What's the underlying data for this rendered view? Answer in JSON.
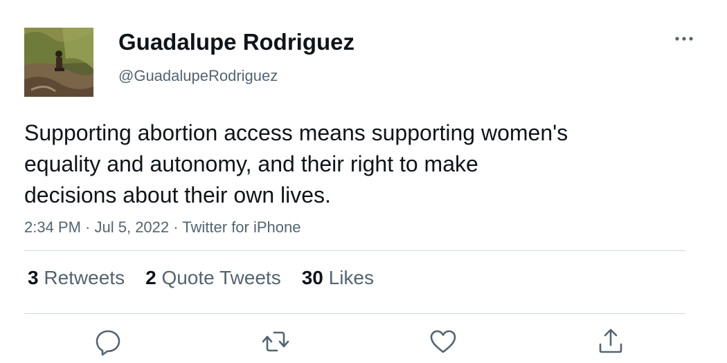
{
  "user": {
    "name": "Guadalupe Rodriguez",
    "handle": "@GuadalupeRodriguez"
  },
  "tweet": {
    "lines": [
      "Supporting abortion access means supporting women's",
      "equality and autonomy, and their right to make",
      "decisions about their own lives."
    ],
    "time": "2:34 PM",
    "date": "Jul 5, 2022",
    "source": "Twitter for iPhone",
    "separator": " · "
  },
  "stats": {
    "retweets_count": "3",
    "retweets_label": "Retweets",
    "quotes_count": "2",
    "quotes_label": "Quote Tweets",
    "likes_count": "30",
    "likes_label": "Likes"
  },
  "icons": {
    "more": "more-horizontal-icon",
    "reply": "reply-icon",
    "retweet": "retweet-icon",
    "like": "heart-icon",
    "share": "share-icon"
  },
  "colors": {
    "text": "#0f1419",
    "secondary": "#536471",
    "divider": "#cfd9de"
  }
}
